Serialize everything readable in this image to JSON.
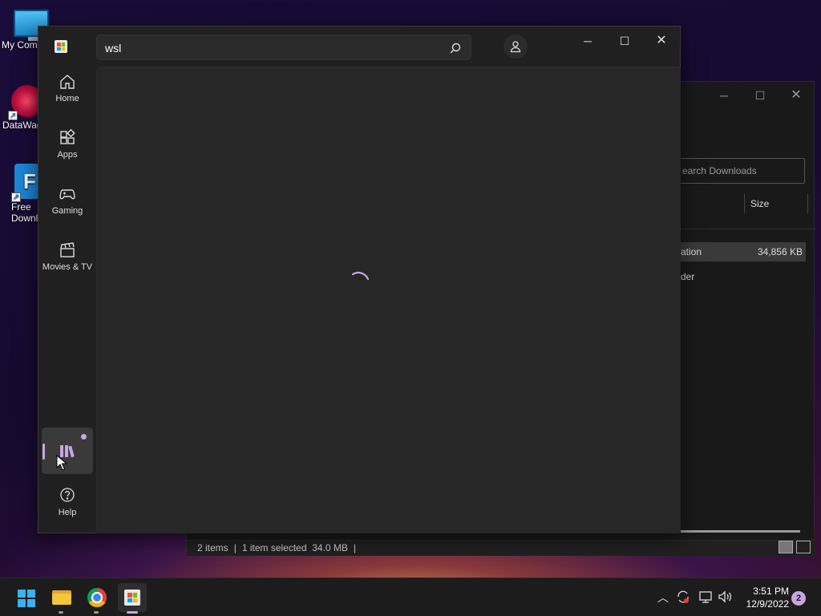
{
  "desktop": {
    "icons": [
      {
        "label": "My Com"
      },
      {
        "label": "DataWag"
      },
      {
        "label": "Free\nDownl"
      }
    ]
  },
  "explorer": {
    "search_placeholder": "earch Downloads",
    "column_size": "Size",
    "rows": [
      {
        "name": "ation",
        "size": "34,856 KB",
        "selected": true
      },
      {
        "name": "der",
        "size": "",
        "selected": false
      }
    ],
    "status": {
      "items": "2 items",
      "selected": "1 item selected",
      "selected_size": "34.0 MB"
    }
  },
  "store": {
    "search_value": "wsl",
    "nav": [
      {
        "label": "Home",
        "icon": "home-icon"
      },
      {
        "label": "Apps",
        "icon": "apps-icon"
      },
      {
        "label": "Gaming",
        "icon": "gaming-icon"
      },
      {
        "label": "Movies & TV",
        "icon": "movies-icon"
      }
    ],
    "library_icon": "library-icon",
    "help_label": "Help",
    "loading": true
  },
  "taskbar": {
    "apps": [
      "start",
      "file-explorer",
      "chrome",
      "microsoft-store"
    ],
    "clock_time": "3:51 PM",
    "clock_date": "12/9/2022",
    "notification_count": "2"
  },
  "colors": {
    "accent": "#c9a4e4",
    "window_bg": "#202020",
    "content_bg": "#272727"
  }
}
